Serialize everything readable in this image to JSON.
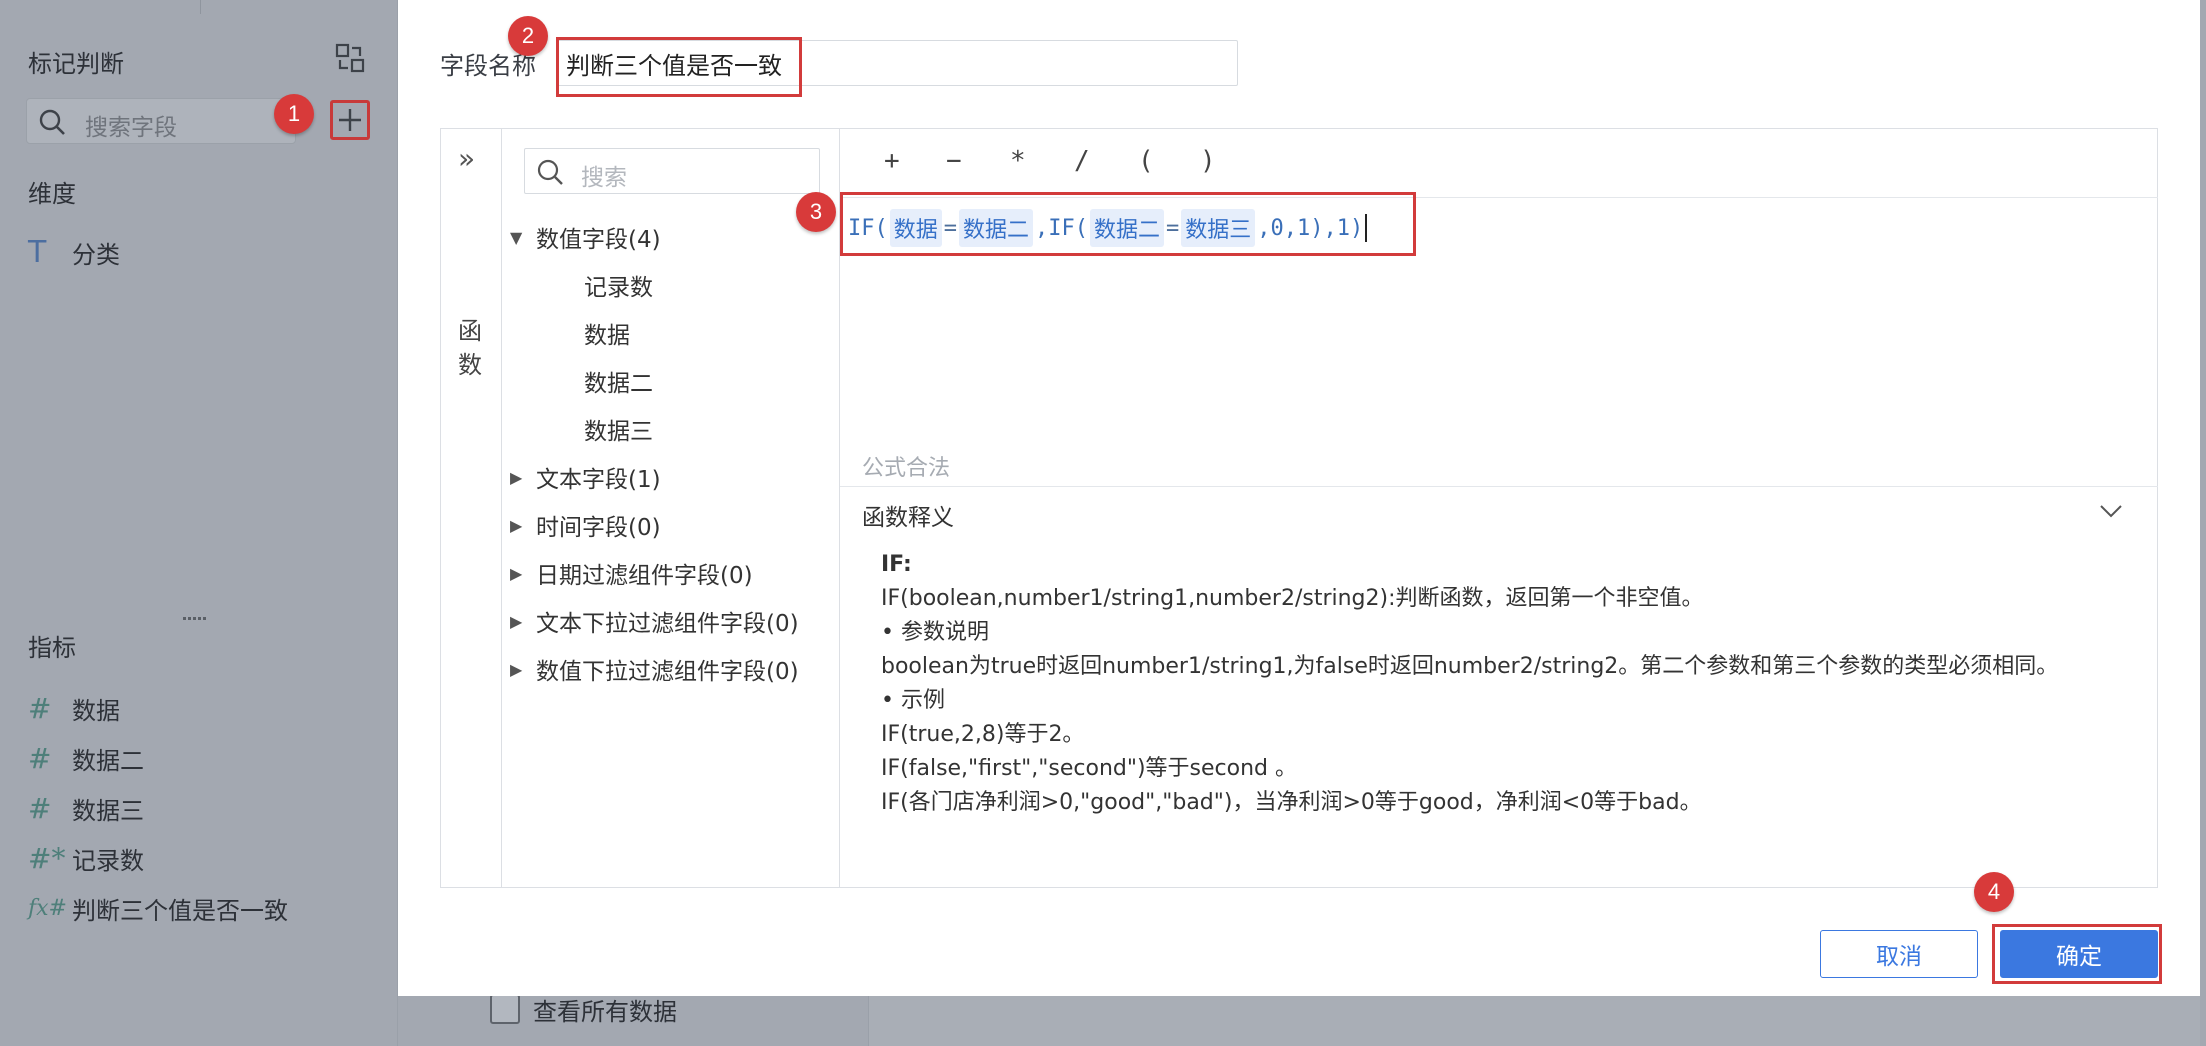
{
  "left_panel": {
    "title": "标记判断",
    "search_placeholder": "搜索字段",
    "dimension_section": "维度",
    "dimensions": [
      {
        "label": "分类",
        "icon": "text-field-icon",
        "glyph": "T"
      }
    ],
    "measure_section": "指标",
    "measures": [
      {
        "label": "数据",
        "icon": "number-field-icon",
        "glyph": "#"
      },
      {
        "label": "数据二",
        "icon": "number-field-icon",
        "glyph": "#"
      },
      {
        "label": "数据三",
        "icon": "number-field-icon",
        "glyph": "#"
      },
      {
        "label": "记录数",
        "icon": "record-count-icon",
        "glyph": "#*"
      },
      {
        "label": "判断三个值是否一致",
        "icon": "formula-field-icon",
        "glyph": "fx#"
      }
    ]
  },
  "background": {
    "view_all_data_label": "查看所有数据"
  },
  "dialog": {
    "field_name_label": "字段名称",
    "field_name_value": "判断三个值是否一致",
    "function_tab_label": "函数",
    "field_search_placeholder": "搜索",
    "tree": {
      "number_fields": "数值字段(4)",
      "number_field_items": [
        "记录数",
        "数据",
        "数据二",
        "数据三"
      ],
      "text_fields": "文本字段(1)",
      "time_fields": "时间字段(0)",
      "date_filter_fields": "日期过滤组件字段(0)",
      "text_dropdown_fields": "文本下拉过滤组件字段(0)",
      "number_dropdown_fields": "数值下拉过滤组件字段(0)"
    },
    "operators": [
      "+",
      "−",
      "*",
      "/",
      "(",
      ")"
    ],
    "formula": {
      "t1": "IF(",
      "f1": "数据",
      "t2": "=",
      "f2": "数据二",
      "t3": ",IF(",
      "f3": "数据二",
      "t4": "=",
      "f4": "数据三",
      "t5": ",0,1),1)"
    },
    "formula_status": "公式合法",
    "description_title": "函数释义",
    "description": {
      "name": "IF:",
      "signature": "IF(boolean,number1/string1,number2/string2):判断函数，返回第一个非空值。",
      "params_heading": "• 参数说明",
      "params": "boolean为true时返回number1/string1,为false时返回number2/string2。第二个参数和第三个参数的类型必须相同。",
      "examples_heading": "• 示例",
      "example1": "IF(true,2,8)等于2。",
      "example2": "IF(false,\"first\",\"second\")等于second 。",
      "example3": "IF(各门店净利润>0,\"good\",\"bad\")，当净利润>0等于good，净利润<0等于bad。"
    },
    "cancel_label": "取消",
    "ok_label": "确定"
  },
  "steps": [
    "1",
    "2",
    "3",
    "4"
  ],
  "colors": {
    "accent": "#3b78e0",
    "highlight": "#d23b3b",
    "step_marker": "#d83a3a",
    "overlay": "#a3a8b1"
  }
}
